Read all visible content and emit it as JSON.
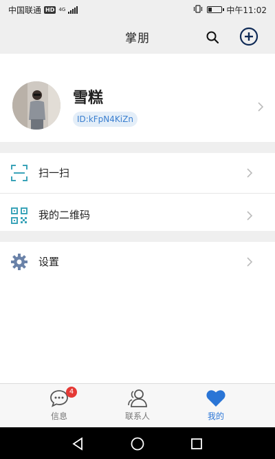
{
  "status_bar": {
    "carrier": "中国联通",
    "hd": "HD",
    "network": "4G",
    "clock": "中午11:02",
    "battery_level": 0.3
  },
  "header": {
    "title": "掌朋",
    "search_icon": "search-icon",
    "add_icon": "add-circle-icon"
  },
  "profile": {
    "name": "雪糕",
    "id_text": "ID:kFpN4KiZn",
    "avatar_icon": "user-photo-avatar"
  },
  "menu": {
    "scan_label": "扫一扫",
    "qrcode_label": "我的二维码",
    "settings_label": "设置"
  },
  "tabbar": {
    "messages_label": "信息",
    "messages_badge": "4",
    "contacts_label": "联系人",
    "me_label": "我的",
    "active_color": "#2a75d6",
    "inactive_color": "#777777"
  },
  "colors": {
    "accent": "#2a75d6",
    "teal_icon": "#3aa3b8",
    "settings_icon": "#6a82a8",
    "badge": "#e53935"
  }
}
